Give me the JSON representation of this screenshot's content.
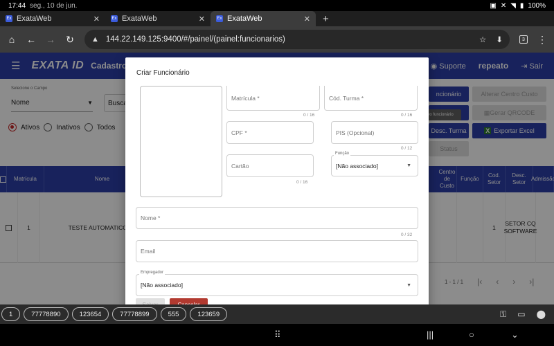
{
  "status": {
    "time": "17:44",
    "date": "seg., 10 de jun.",
    "battery": "100%",
    "icons": [
      "lock-icon",
      "mute-icon",
      "wifi-icon",
      "battery-icon"
    ]
  },
  "tabs": [
    {
      "title": "ExataWeb",
      "favicon": "Ex",
      "active": false
    },
    {
      "title": "ExataWeb",
      "favicon": "Ex",
      "active": false
    },
    {
      "title": "ExataWeb",
      "favicon": "Ex",
      "active": true
    }
  ],
  "browser": {
    "url": "144.22.149.125:9400/#/painel/(painel:funcionarios)",
    "tab_count": "3"
  },
  "app": {
    "logo": "EXATA",
    "logo_id": "ID",
    "title": "Cadastro",
    "support": "Suporte",
    "user": "repeato",
    "logout": "Sair",
    "accent": "#2c3ea8"
  },
  "background": {
    "filter_label": "Selecione o Campo",
    "filter_value": "Nome",
    "search_prefix": "Busca",
    "radios": [
      "Ativos",
      "Inativos",
      "Todos"
    ],
    "buttons": {
      "new_employee": "ncionário",
      "change_cost_center": "Alterar Centro Custo",
      "tooltip": "vo funcionário",
      "generate_qrcode": "Gerar QRCODE",
      "desc_class": "Desc. Turma",
      "export_excel": "Exportar Excel",
      "status": "Status"
    },
    "columns": [
      "Matrícula",
      "Nome",
      "Centro de Custo",
      "Função",
      "Cod. Setor",
      "Desc. Setor",
      "Admissão"
    ],
    "rows": [
      {
        "matricula": "1",
        "nome": "TESTE AUTOMATICO R",
        "centro_custo": "",
        "funcao": "",
        "cod_setor": "1",
        "desc_setor": "SETOR CQ SOFTWARE"
      }
    ],
    "pagination": "1 - 1 / 1"
  },
  "dialog": {
    "title": "Criar Funcionário",
    "fields": {
      "matricula": {
        "placeholder": "Matrícula *",
        "counter": "0 / 16"
      },
      "cod_turma": {
        "placeholder": "Cód. Turma *",
        "counter": "0 / 16"
      },
      "cpf": {
        "placeholder": "CPF *"
      },
      "pis": {
        "placeholder": "PIS (Opcional)",
        "counter": "0 / 12"
      },
      "funcao": {
        "label": "Função",
        "value": "[Não associado]"
      },
      "cartao": {
        "placeholder": "Cartão",
        "counter": "0 / 16"
      },
      "nome": {
        "placeholder": "Nome *",
        "counter": "0 / 32"
      },
      "email": {
        "placeholder": "Email"
      },
      "empregador": {
        "label": "Empregador",
        "value": "[Não associado]"
      }
    },
    "save": "Salvar",
    "cancel": "Cancelar"
  },
  "chips": [
    "1",
    "77778890",
    "123654",
    "77778899",
    "555",
    "123659"
  ]
}
